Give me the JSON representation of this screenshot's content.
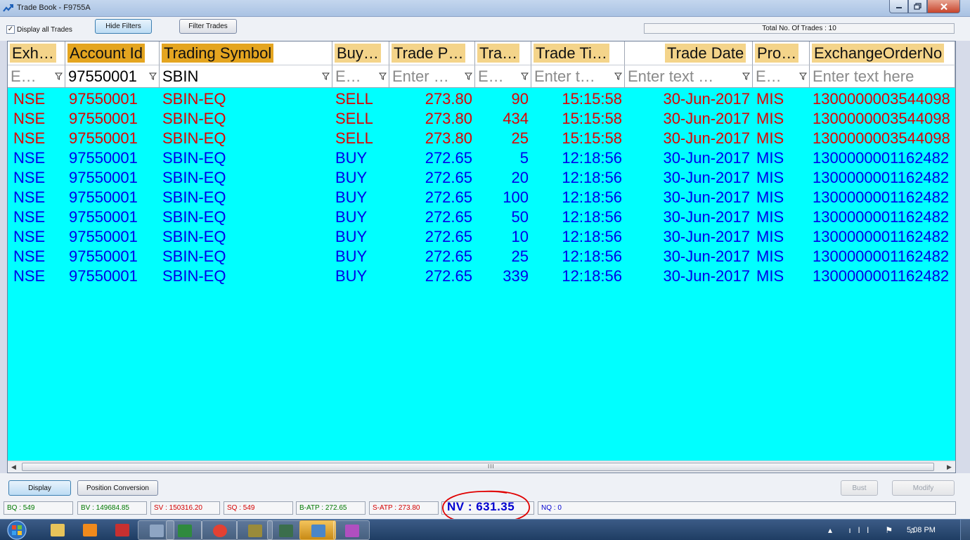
{
  "window": {
    "title": "Trade Book - F9755A"
  },
  "toolbar": {
    "display_all_label": "Display all Trades",
    "display_all_checked": "✓",
    "hide_filters_label": "Hide Filters",
    "filter_trades_label": "Filter Trades",
    "total_trades_text": "Total No. Of Trades : 10"
  },
  "grid": {
    "headers": [
      "Exh…",
      "Account Id",
      "Trading Symbol",
      "Buy…",
      "Trade P…",
      "Tra…",
      "Trade Ti…",
      "Trade Date",
      "Pro…",
      "ExchangeOrderNo"
    ],
    "filters": [
      "E…",
      "97550001",
      "SBIN",
      "E…",
      "Enter …",
      "E…",
      "Enter t…",
      "Enter text …",
      "E…",
      "Enter text here"
    ],
    "rows": [
      {
        "side_class": "sell",
        "cells": [
          "NSE",
          "97550001",
          "SBIN-EQ",
          "SELL",
          "273.80",
          "90",
          "15:15:58",
          "30-Jun-2017",
          "MIS",
          "1300000003544098"
        ]
      },
      {
        "side_class": "sell",
        "cells": [
          "NSE",
          "97550001",
          "SBIN-EQ",
          "SELL",
          "273.80",
          "434",
          "15:15:58",
          "30-Jun-2017",
          "MIS",
          "1300000003544098"
        ]
      },
      {
        "side_class": "sell",
        "cells": [
          "NSE",
          "97550001",
          "SBIN-EQ",
          "SELL",
          "273.80",
          "25",
          "15:15:58",
          "30-Jun-2017",
          "MIS",
          "1300000003544098"
        ]
      },
      {
        "side_class": "buy",
        "cells": [
          "NSE",
          "97550001",
          "SBIN-EQ",
          "BUY",
          "272.65",
          "5",
          "12:18:56",
          "30-Jun-2017",
          "MIS",
          "1300000001162482"
        ]
      },
      {
        "side_class": "buy",
        "cells": [
          "NSE",
          "97550001",
          "SBIN-EQ",
          "BUY",
          "272.65",
          "20",
          "12:18:56",
          "30-Jun-2017",
          "MIS",
          "1300000001162482"
        ]
      },
      {
        "side_class": "buy",
        "cells": [
          "NSE",
          "97550001",
          "SBIN-EQ",
          "BUY",
          "272.65",
          "100",
          "12:18:56",
          "30-Jun-2017",
          "MIS",
          "1300000001162482"
        ]
      },
      {
        "side_class": "buy",
        "cells": [
          "NSE",
          "97550001",
          "SBIN-EQ",
          "BUY",
          "272.65",
          "50",
          "12:18:56",
          "30-Jun-2017",
          "MIS",
          "1300000001162482"
        ]
      },
      {
        "side_class": "buy",
        "cells": [
          "NSE",
          "97550001",
          "SBIN-EQ",
          "BUY",
          "272.65",
          "10",
          "12:18:56",
          "30-Jun-2017",
          "MIS",
          "1300000001162482"
        ]
      },
      {
        "side_class": "buy",
        "cells": [
          "NSE",
          "97550001",
          "SBIN-EQ",
          "BUY",
          "272.65",
          "25",
          "12:18:56",
          "30-Jun-2017",
          "MIS",
          "1300000001162482"
        ]
      },
      {
        "side_class": "buy",
        "cells": [
          "NSE",
          "97550001",
          "SBIN-EQ",
          "BUY",
          "272.65",
          "339",
          "12:18:56",
          "30-Jun-2017",
          "MIS",
          "1300000001162482"
        ]
      }
    ],
    "scroll_grip": "III"
  },
  "actions": {
    "display_label": "Display",
    "position_conversion_label": "Position Conversion",
    "bust_label": "Bust",
    "modify_label": "Modify"
  },
  "summary": {
    "bq": "BQ : 549",
    "bv": "BV : 149684.85",
    "sv": "SV : 150316.20",
    "sq": "SQ : 549",
    "batp": "B-ATP : 272.65",
    "satp": "S-ATP : 273.80",
    "nv": "NV : 631.35",
    "nq": "NQ : 0"
  },
  "taskbar": {
    "clock": "5:08 PM",
    "tray_icons": [
      "show-hidden-icons",
      "network-icon",
      "flag-icon",
      "volume-icon"
    ]
  },
  "colors": {
    "grid_bg": "#00ffff",
    "sell": "#e00000",
    "buy": "#0000e8",
    "header_highlight": "#f4d48a",
    "header_selected": "#e4a520",
    "annotation": "#e00000"
  }
}
